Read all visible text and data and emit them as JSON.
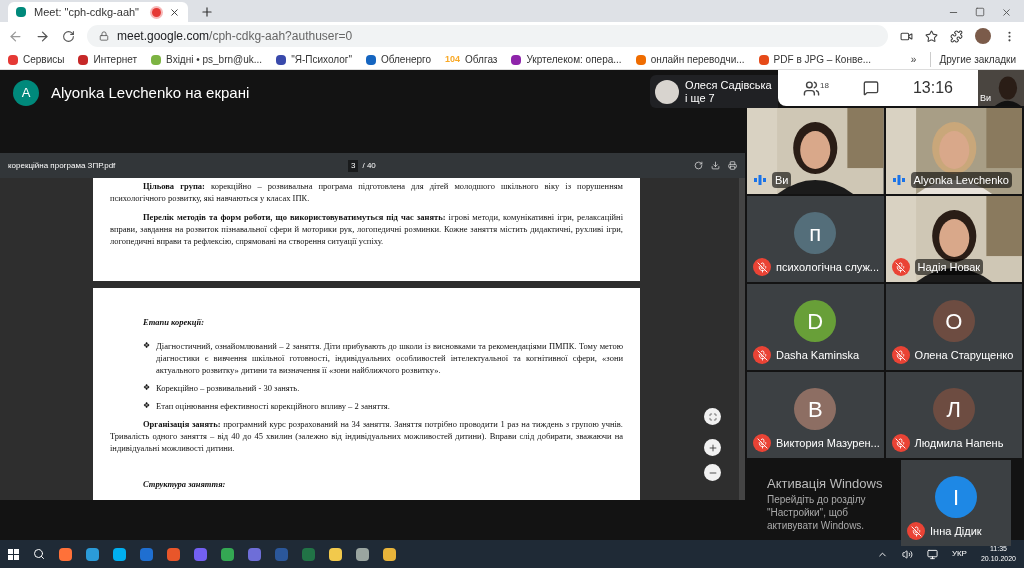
{
  "browser": {
    "tab": {
      "title": "Meet: \"cph-cdkg-aah\"",
      "recording": true
    },
    "url": {
      "host": "meet.google.com",
      "path": "/cph-cdkg-aah?authuser=0"
    },
    "bookmarks": [
      {
        "label": "Сервисы",
        "color": "#e53935"
      },
      {
        "label": "Интернет",
        "color": "#c62828"
      },
      {
        "label": "Вхідні • ps_brn@uk...",
        "color": "#7cb342"
      },
      {
        "label": "\"Я-Психолог\"",
        "color": "#3949ab"
      },
      {
        "label": "Обленерго",
        "color": "#1565c0"
      },
      {
        "label": "Облгаз",
        "badge": "104",
        "color": "#f9a825"
      },
      {
        "label": "Укртелеком: опера...",
        "color": "#8e24aa"
      },
      {
        "label": "онлайн переводчи...",
        "color": "#ef6c00"
      },
      {
        "label": "PDF в JPG – Конве...",
        "color": "#e64a19"
      }
    ],
    "overflow": "»",
    "other_bookmarks": "Другие закладки"
  },
  "meet": {
    "presenter": {
      "initial": "A",
      "color": "#00897b",
      "title": "Alyonka Levchenko на екрані"
    },
    "chip": {
      "name": "Олеся Садівська",
      "more": "і ще 7"
    },
    "people_count": "18",
    "time": "13:16",
    "self_label": "Ви"
  },
  "pdf": {
    "filename": "корекційна програма ЗПР.pdf",
    "page": "3",
    "total": "/ 40",
    "page_one": [
      "**Цільова група:** корекційно – розвивальна програма підготовлена для дітей молодшого шкільного віку із порушенням психологічного розвитку, які навчаються у класах ІПК.",
      "**Перелік методів та форм роботи, що використовуватимуться під час занять:** ігрові методи, комунікативні ігри, релаксаційні вправи, завдання на розвиток пізнавальної сфери й моторики рук, логопедичні розминки. Кожне заняття містить дидактичні, рухливі ігри, логопедичні вправи та рефлексію, спрямовані на створення ситуації успіху."
    ],
    "page_two": [
      {
        "kind": "heading",
        "text": "Етапи корекції:"
      },
      {
        "kind": "bullet",
        "marker": "❖",
        "text": "Діагностичний, ознайомлюваний – 2 заняття. Діти прибувають до школи із висновками та рекомендаціями ПМПК. Тому метою діагностики є вивчення шкільної готовності, індивідуальних особливостей інтелектуальної та когнітивної сфери, «зони актуального розвитку» дитини та визначення її «зони найближчого розвитку»."
      },
      {
        "kind": "bullet",
        "marker": "❖",
        "text": "Корекційно – розвивальний  - 30 занять."
      },
      {
        "kind": "bullet",
        "marker": "❖",
        "text": "Етап оцінювання ефективності корекційного впливу – 2 заняття."
      },
      {
        "kind": "paragraph",
        "text": "**Організація занять:** програмний курс розрахований на 34 заняття. Заняття потрібно проводити 1 раз на тиждень з групою учнів. Тривалість одного заняття – від 40 до 45 хвилин (залежно від індивідуальних можливостей дитини). Вправи слід добирати, зважаючи на індивідуальні можливості дитини."
      },
      {
        "kind": "heading",
        "text": "Структура заняття:"
      }
    ]
  },
  "tiles": [
    {
      "kind": "video",
      "name": "Ви",
      "muted": false
    },
    {
      "kind": "video",
      "name": "Alyonka Levchenko",
      "muted": false
    },
    {
      "kind": "avatar",
      "initial": "п",
      "color": "#546e7a",
      "name": "психологічна служ...",
      "muted": true
    },
    {
      "kind": "video",
      "name": "Надія Новак",
      "muted": true
    },
    {
      "kind": "avatar",
      "initial": "D",
      "color": "#689f38",
      "name": "Dasha Kaminska",
      "muted": true
    },
    {
      "kind": "avatar",
      "initial": "О",
      "color": "#6d4c41",
      "name": "Олена Старущенко",
      "muted": true
    },
    {
      "kind": "avatar",
      "initial": "В",
      "color": "#8d6e63",
      "name": "Виктория Мазурен...",
      "muted": true
    },
    {
      "kind": "avatar",
      "initial": "Л",
      "color": "#6d4c41",
      "name": "Людмила Напень",
      "muted": true
    },
    {
      "kind": "avatar",
      "initial": "І",
      "color": "#1e88e5",
      "name": "Інна Дідик",
      "muted": true
    }
  ],
  "activation": {
    "title": "Активація Windows",
    "text": "Перейдіть до розділу \"Настройки\", щоб активувати Windows."
  },
  "taskbar": {
    "language": "УКР",
    "time": "11:35",
    "date": "20.10.2020"
  }
}
